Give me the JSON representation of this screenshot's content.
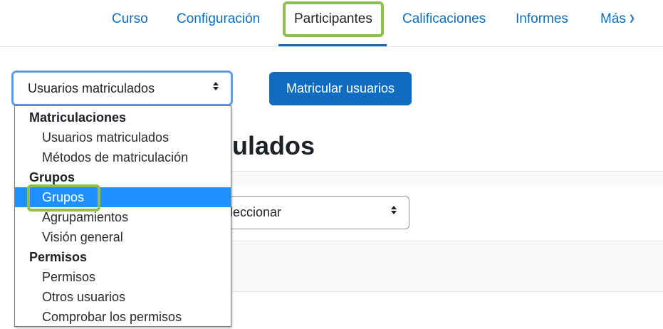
{
  "nav": {
    "tabs": [
      {
        "label": "Curso"
      },
      {
        "label": "Configuración"
      },
      {
        "label": "Participantes"
      },
      {
        "label": "Calificaciones"
      },
      {
        "label": "Informes"
      },
      {
        "label": "Más"
      }
    ],
    "active_tab": "Participantes"
  },
  "enrol_select": {
    "value": "Usuarios matriculados"
  },
  "enrol_button": {
    "label": "Matricular usuarios"
  },
  "page": {
    "title_visible": "ulados"
  },
  "filter_select": {
    "value_visible": "eleccionar"
  },
  "dropdown": {
    "groups": [
      {
        "label": "Matriculaciones",
        "options": [
          "Usuarios matriculados",
          "Métodos de matriculación"
        ]
      },
      {
        "label": "Grupos",
        "options": [
          "Grupos",
          "Agrupamientos",
          "Visión general"
        ]
      },
      {
        "label": "Permisos",
        "options": [
          "Permisos",
          "Otros usuarios",
          "Comprobar los permisos"
        ]
      }
    ],
    "selected": "Grupos"
  },
  "colors": {
    "link": "#0f6cbf",
    "highlight_outline": "#8fc04a",
    "selected_option": "#1e90ff",
    "focus_border": "#5d9de0"
  }
}
